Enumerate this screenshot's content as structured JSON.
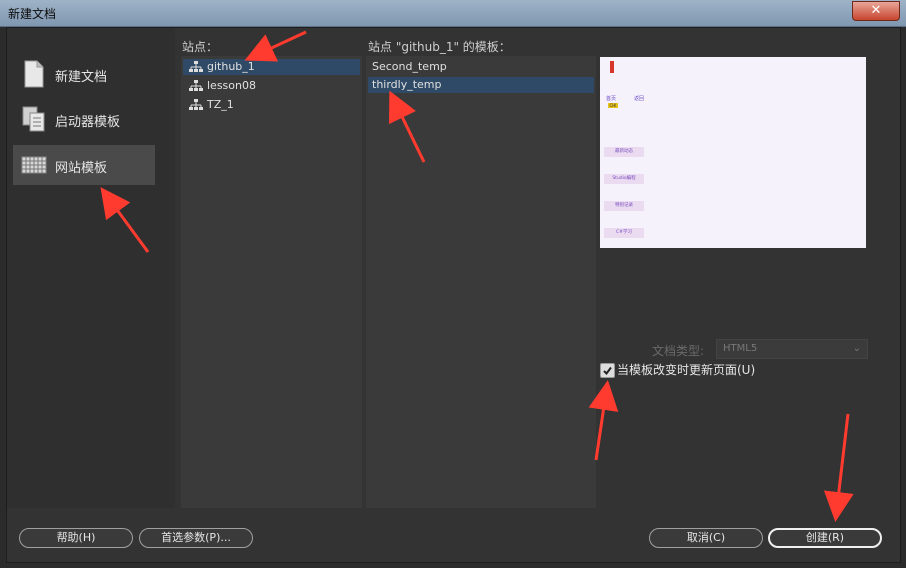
{
  "window": {
    "title": "新建文档",
    "close_glyph": "✕"
  },
  "sidebar": {
    "items": [
      {
        "label": "新建文档",
        "icon": "document-icon"
      },
      {
        "label": "启动器模板",
        "icon": "copy-icon"
      },
      {
        "label": "网站模板",
        "icon": "grid-icon"
      }
    ]
  },
  "sites": {
    "label": "站点：",
    "items": [
      "github_1",
      "lesson08",
      "TZ_1"
    ],
    "selected": "github_1"
  },
  "templates": {
    "label": "站点 \"github_1\" 的模板：",
    "items": [
      "Second_temp",
      "thirdly_temp"
    ],
    "selected": "thirdly_temp"
  },
  "preview": {
    "nav_home": "首页",
    "nav_back": "返回",
    "tag": "CHI",
    "boxes": [
      "最新动态",
      "Studio编程",
      "特别记录",
      "C#学习"
    ]
  },
  "doc_type": {
    "label": "文档类型:",
    "value": "HTML5"
  },
  "update_checkbox": {
    "label": "当模板改变时更新页面(U)",
    "checked": true
  },
  "buttons": {
    "help": "帮助(H)",
    "prefs": "首选参数(P)...",
    "cancel": "取消(C)",
    "create": "创建(R)"
  },
  "colors": {
    "selection": "#2e4a66",
    "arrow": "#ff3b2f"
  }
}
